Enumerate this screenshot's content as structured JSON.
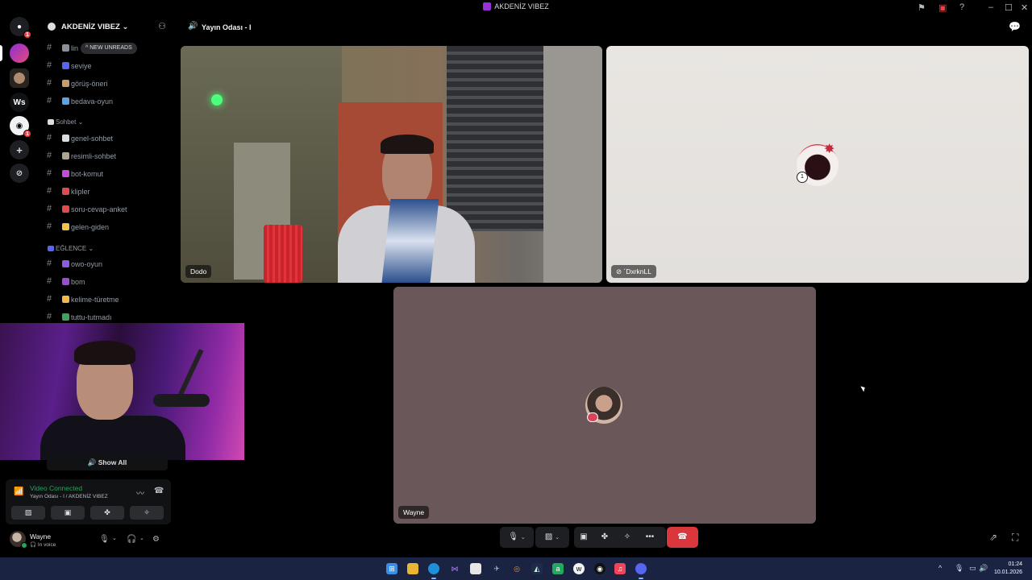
{
  "titlebar": {
    "title": "AKDENİZ VIBEZ"
  },
  "server_rail": {
    "ws_label": "Ws",
    "dm_badge": "1",
    "badge2": "1"
  },
  "sidebar": {
    "server_name": "AKDENİZ VIBEZ",
    "new_unreads": "NEW UNREADS",
    "channels_top": [
      {
        "label": "lin",
        "emoji_color": "#8a8f99"
      },
      {
        "label": "seviye",
        "emoji_color": "#5865f2"
      },
      {
        "label": "görüş-öneri",
        "emoji_color": "#c99a6a"
      },
      {
        "label": "bedava-oyun",
        "emoji_color": "#5aa3e8"
      }
    ],
    "categories": [
      {
        "label": "Sohbet",
        "emoji_color": "#dbdee1"
      },
      {
        "label": "EĞLENCE",
        "emoji_color": "#5865f2"
      }
    ],
    "channels_sohbet": [
      {
        "label": "genel-sohbet",
        "emoji_color": "#dbdee1"
      },
      {
        "label": "resimli-sohbet",
        "emoji_color": "#b0a58c"
      },
      {
        "label": "bot-komut",
        "emoji_color": "#c44ad8"
      },
      {
        "label": "klipler",
        "emoji_color": "#e04a4a"
      },
      {
        "label": "soru-cevap-anket",
        "emoji_color": "#e04a4a"
      },
      {
        "label": "gelen-giden",
        "emoji_color": "#f2c24a"
      }
    ],
    "channels_eglence": [
      {
        "label": "owo-oyun",
        "emoji_color": "#8a5ce6"
      },
      {
        "label": "bom",
        "emoji_color": "#9c4ad8"
      },
      {
        "label": "kelime-türetme",
        "emoji_color": "#f2b84a"
      },
      {
        "label": "tuttu-tutmadı",
        "emoji_color": "#3ba55c"
      }
    ],
    "show_all": "Show All"
  },
  "voice_panel": {
    "status": "Video Connected",
    "location": "Yayın Odası - I / AKDENİZ VIBEZ"
  },
  "user_panel": {
    "username": "Wayne",
    "status": "In voice"
  },
  "main": {
    "channel_title": "Yayın Odası - I"
  },
  "tiles": [
    {
      "name": "Dodo"
    },
    {
      "name": "´DxrknLL"
    },
    {
      "name": "Wayne"
    }
  ],
  "tile_badges": {
    "dxrk_badge": "1"
  },
  "taskbar": {
    "time": "01:24",
    "date": "10.01.2026"
  },
  "colors": {
    "accent_green": "#23a55a",
    "danger_red": "#da373c",
    "taskbar_bg": "#1a2342"
  }
}
